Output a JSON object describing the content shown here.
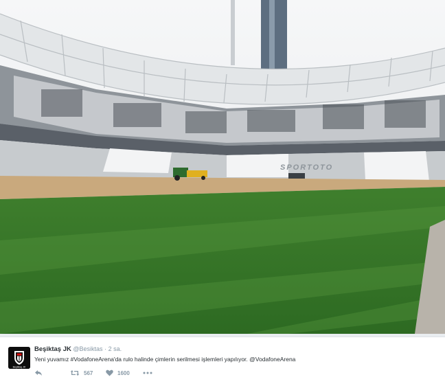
{
  "photo": {
    "stand_signage": "SPORTOTO",
    "icon": "stadium-photo"
  },
  "tweet": {
    "author": {
      "name": "Beşiktaş JK",
      "handle": "@Besiktas",
      "separator": "·",
      "time": "2 sa.",
      "avatar_label": "Beşiktaş JK"
    },
    "text_before": "Yeni yuvamız ",
    "hashtag": "#VodafoneArena",
    "text_after": "'da rulo halinde çimlerin serilmesi işlemleri yapılıyor. ",
    "mention": "@VodafoneArena",
    "actions": {
      "reply_icon": "reply-icon",
      "retweet_icon": "retweet-icon",
      "retweets": "567",
      "like_icon": "heart-icon",
      "likes": "1600",
      "more_icon": "more-icon"
    }
  },
  "colors": {
    "grass_dark": "#2f6d24",
    "grass_light": "#4a8c34",
    "sand": "#c9a97d",
    "sky": "#f1f3f4",
    "text_muted": "#8899a6"
  }
}
